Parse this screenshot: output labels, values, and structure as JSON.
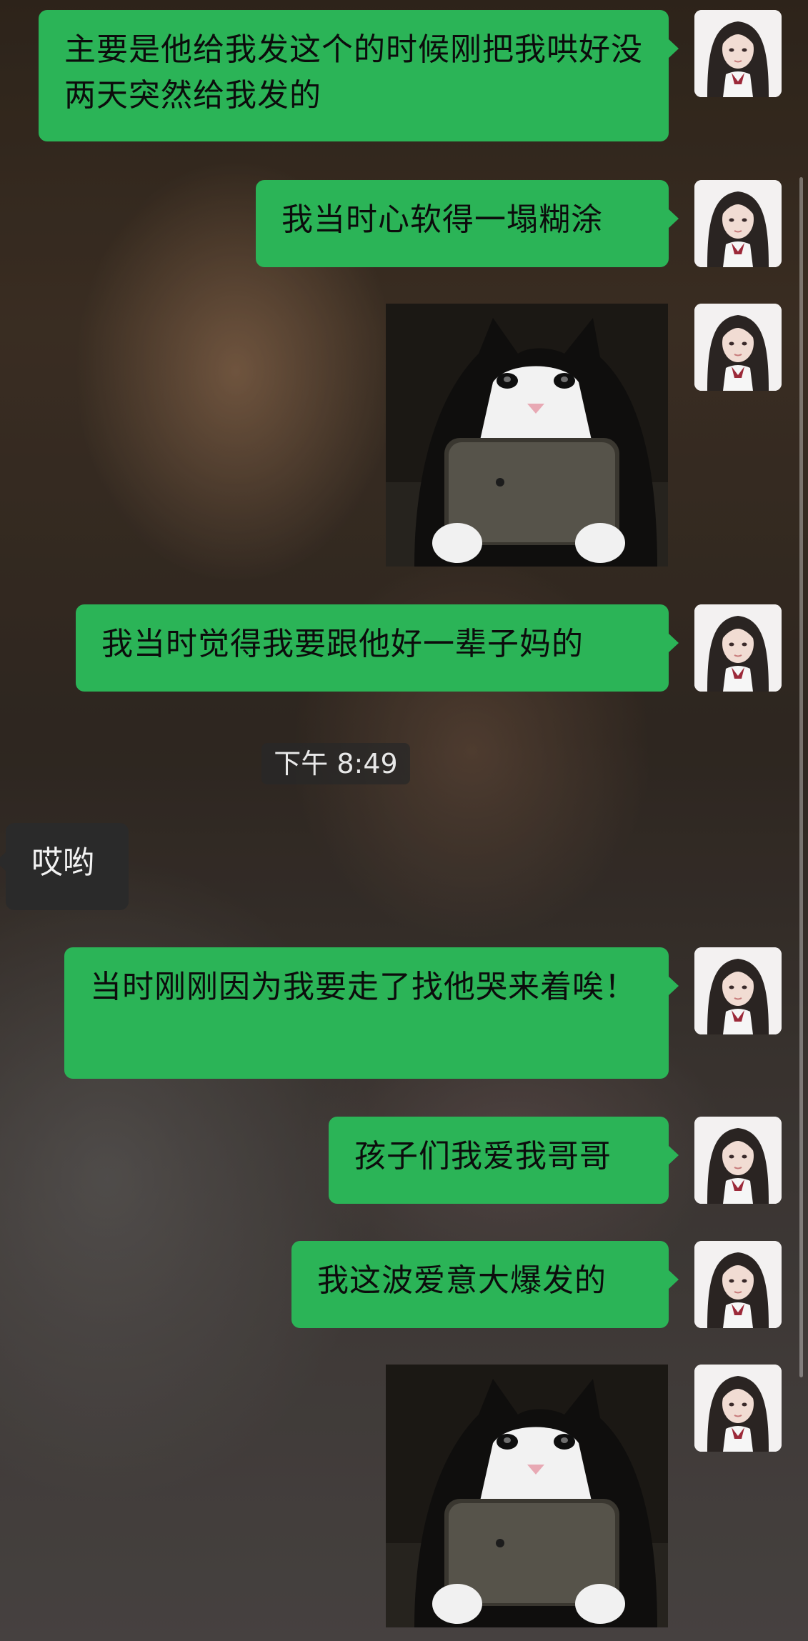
{
  "conversation": {
    "timestamp": "下午 8:49",
    "messages": [
      {
        "id": "m1",
        "text": "主要是他给我发这个的时候刚把我哄好没两天突然给我发的"
      },
      {
        "id": "m2",
        "text": "我当时心软得一塌糊涂"
      },
      {
        "id": "m3",
        "sticker": "crying-cat-holding-phone-sticker"
      },
      {
        "id": "m4",
        "text": "我当时觉得我要跟他好一辈子妈的"
      },
      {
        "id": "m5",
        "text": "哎哟"
      },
      {
        "id": "m6",
        "text": "当时刚刚因为我要走了找他哭来着唉！"
      },
      {
        "id": "m7",
        "text": "孩子们我爱我哥哥"
      },
      {
        "id": "m8",
        "text": "我这波爱意大爆发的"
      },
      {
        "id": "m9",
        "sticker": "crying-cat-holding-phone-sticker"
      }
    ]
  },
  "colors": {
    "outgoing_bubble": "#2bb457",
    "incoming_bubble": "#2a2a2a",
    "timestamp_bg": "#282828"
  },
  "icons": {
    "avatar": "girl-portrait-avatar",
    "sticker": "crying-cat-holding-phone"
  }
}
